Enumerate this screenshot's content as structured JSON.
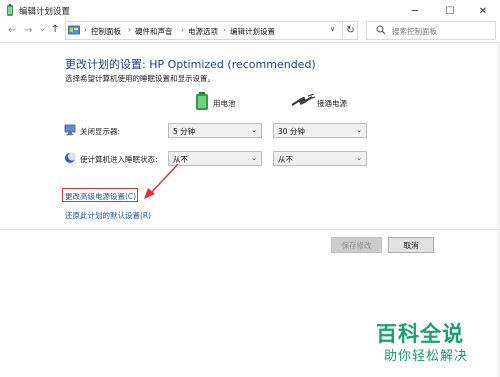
{
  "window": {
    "title": "编辑计划设置"
  },
  "controls": {
    "min": "─",
    "max": "☐",
    "close": "✕"
  },
  "nav": {
    "back": "←",
    "forward": "→",
    "dropdown": "⌄",
    "up": "↑"
  },
  "breadcrumb": {
    "sep": "›",
    "items": [
      "控制面板",
      "硬件和声音",
      "电源选项",
      "编辑计划设置"
    ],
    "dropdown": "∨"
  },
  "refresh": "↻",
  "search": {
    "placeholder": "搜索控制面板"
  },
  "main": {
    "title": "更改计划的设置: HP Optimized (recommended)",
    "subtitle": "选择希望计算机使用的睡眠设置和显示设置。",
    "col_battery": "用电池",
    "col_plugged": "接通电源",
    "rows": [
      {
        "label": "关闭显示器:",
        "battery": "5 分钟",
        "plugged": "30 分钟"
      },
      {
        "label": "使计算机进入睡眠状态:",
        "battery": "从不",
        "plugged": "从不"
      }
    ],
    "caret": "⌄",
    "advanced_link": "更改高级电源设置(C)",
    "restore_link": "还原此计划的默认设置(R)"
  },
  "buttons": {
    "save": "保存修改",
    "cancel": "取消"
  },
  "watermark": {
    "title": "百科全说",
    "subtitle": "助你轻松解决"
  },
  "colors": {
    "title_blue": "#1e3e8c",
    "link_blue": "#1556b8",
    "highlight_red": "#e23030",
    "watermark_green": "#17a26f"
  }
}
